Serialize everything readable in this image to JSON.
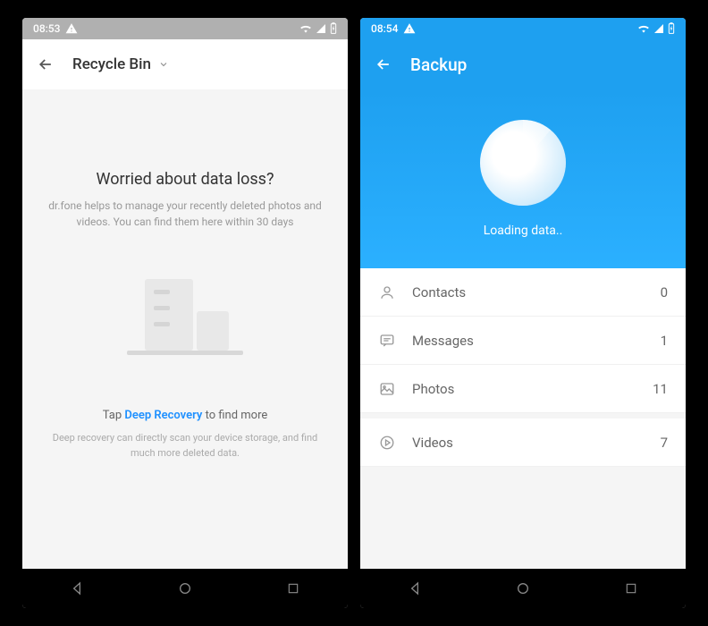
{
  "phone1": {
    "status_time": "08:53",
    "app_title": "Recycle Bin",
    "heading": "Worried about data loss?",
    "sub": "dr.fone helps to manage your recently deleted photos and videos. You can find them here within 30 days",
    "tap_prefix": "Tap ",
    "tap_link": "Deep Recovery",
    "tap_suffix": " to find more",
    "deep_desc": "Deep recovery can directly scan your device storage, and find much more deleted data."
  },
  "phone2": {
    "status_time": "08:54",
    "app_title": "Backup",
    "loading": "Loading data..",
    "items": [
      {
        "label": "Contacts",
        "count": "0",
        "icon": "contact"
      },
      {
        "label": "Messages",
        "count": "1",
        "icon": "message"
      },
      {
        "label": "Photos",
        "count": "11",
        "icon": "photo"
      },
      {
        "label": "Videos",
        "count": "7",
        "icon": "video"
      }
    ]
  }
}
